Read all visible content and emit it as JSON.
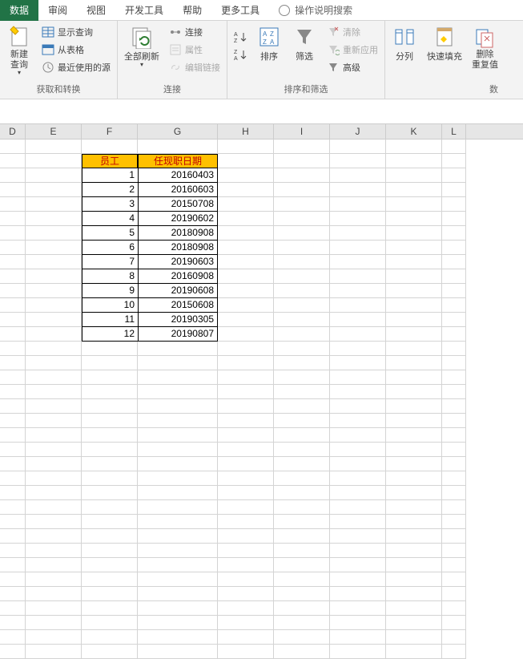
{
  "tabs": {
    "active": "数据",
    "items": [
      "审阅",
      "视图",
      "开发工具",
      "帮助",
      "更多工具"
    ],
    "tellme": "操作说明搜索"
  },
  "ribbon": {
    "group1": {
      "label": "获取和转换",
      "newquery": "新建\n查询",
      "showquery": "显示查询",
      "fromtable": "从表格",
      "recent": "最近使用的源"
    },
    "group2": {
      "label": "连接",
      "refreshall": "全部刷新",
      "connections": "连接",
      "properties": "属性",
      "editlinks": "编辑链接"
    },
    "group3": {
      "label": "排序和筛选",
      "sort": "排序",
      "filter": "筛选",
      "clear": "清除",
      "reapply": "重新应用",
      "advanced": "高级"
    },
    "group4": {
      "split": "分列",
      "flashfill": "快速填充",
      "dedup": "删除\n重复值"
    }
  },
  "columns": [
    "D",
    "E",
    "F",
    "G",
    "H",
    "I",
    "J",
    "K",
    "L"
  ],
  "table": {
    "headers": {
      "col1": "员工",
      "col2": "任现职日期"
    },
    "rows": [
      {
        "id": "1",
        "date": "20160403"
      },
      {
        "id": "2",
        "date": "20160603"
      },
      {
        "id": "3",
        "date": "20150708"
      },
      {
        "id": "4",
        "date": "20190602"
      },
      {
        "id": "5",
        "date": "20180908"
      },
      {
        "id": "6",
        "date": "20180908"
      },
      {
        "id": "7",
        "date": "20190603"
      },
      {
        "id": "8",
        "date": "20160908"
      },
      {
        "id": "9",
        "date": "20190608"
      },
      {
        "id": "10",
        "date": "20150608"
      },
      {
        "id": "11",
        "date": "20190305"
      },
      {
        "id": "12",
        "date": "20190807"
      }
    ]
  }
}
